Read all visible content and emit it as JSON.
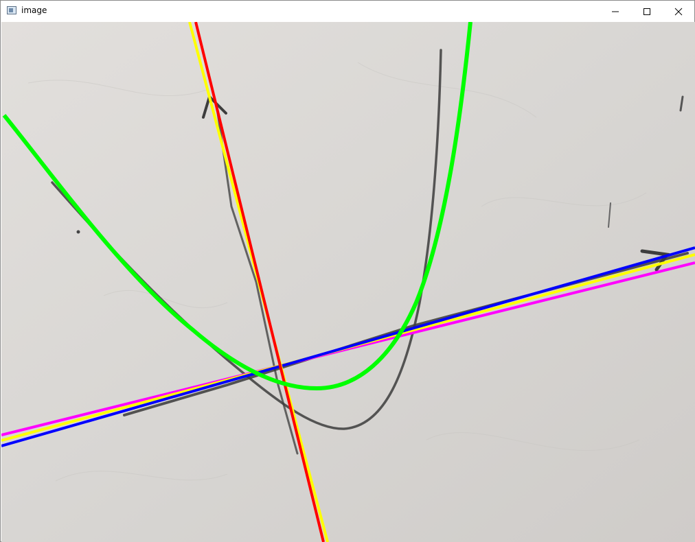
{
  "window": {
    "title": "image",
    "icon": "app-window-icon",
    "controls": {
      "minimize_icon": "minimize-icon",
      "maximize_icon": "maximize-icon",
      "close_icon": "close-icon"
    }
  },
  "image_view": {
    "background_color": "#dcd9d6",
    "overlay_colors": {
      "red_line": "#ff0000",
      "yellow_line": "#ffff00",
      "blue_line": "#0000ff",
      "magenta_line": "#ff00ff",
      "green_curve": "#00ff00",
      "hand_drawn_marker": "#4a4a4a"
    }
  }
}
